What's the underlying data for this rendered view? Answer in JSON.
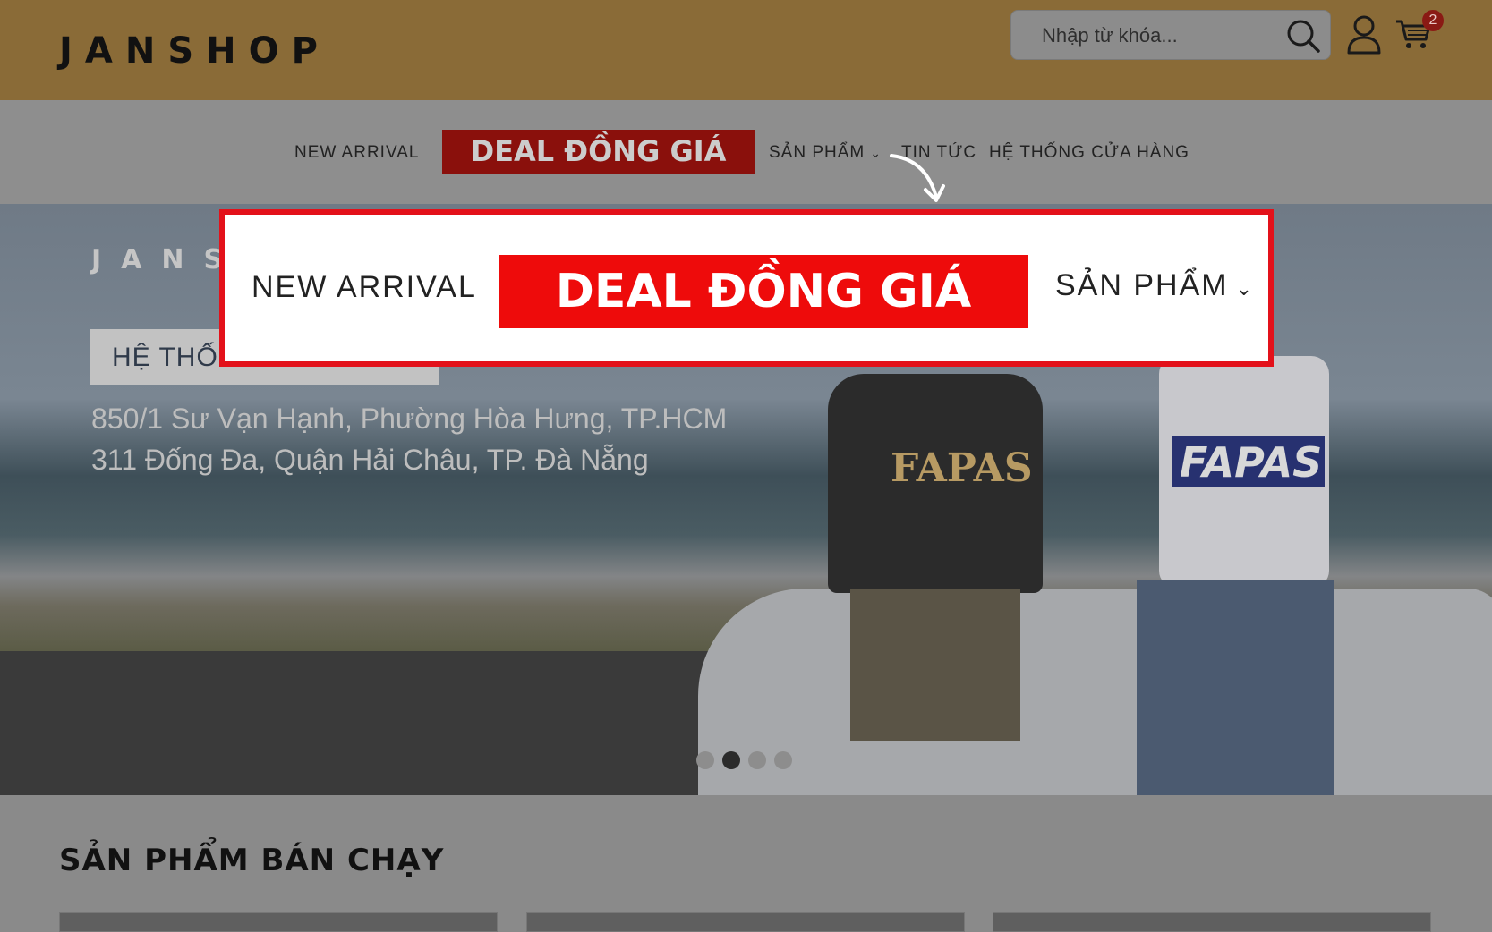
{
  "header": {
    "logo": "JANSHOP",
    "search_placeholder": "Nhập từ khóa...",
    "cart_count": "2",
    "colors": {
      "header_bg": "#8a6b37",
      "badge": "#8a1a14"
    }
  },
  "nav": {
    "items": [
      {
        "label": "NEW ARRIVAL"
      },
      {
        "label": "DEAL ĐỒNG GIÁ"
      },
      {
        "label": "SẢN PHẨM",
        "chevron": "⌄"
      },
      {
        "label": "TIN TỨC"
      },
      {
        "label": "HỆ THỐNG CỬA HÀNG"
      }
    ]
  },
  "hero": {
    "brand": "JANSHOP",
    "box_label": "HỆ THỐ",
    "address_1": "850/1 Sư Vạn Hạnh, Phường Hòa Hưng, TP.HCM",
    "address_2": "311 Đống Đa, Quận Hải Châu, TP. Đà Nẵng",
    "shirt_logo_1": "FAPAS",
    "shirt_logo_2": "FAPAS",
    "slide_count": 4,
    "active_slide": 2
  },
  "section": {
    "title": "SẢN PHẨM BÁN CHẠY"
  },
  "callout": {
    "new_arrival": "NEW ARRIVAL",
    "deal": "DEAL ĐỒNG GIÁ",
    "products": "SẢN PHẨM",
    "chevron": "⌄",
    "colors": {
      "border": "#e3111a",
      "deal_bg": "#ee0b0b"
    }
  }
}
